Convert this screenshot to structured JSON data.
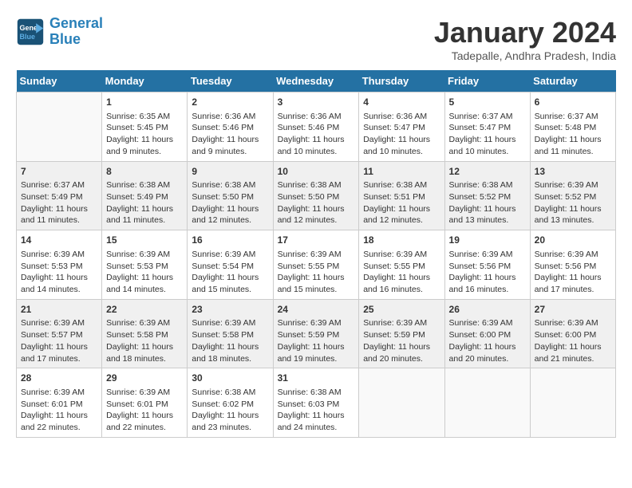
{
  "header": {
    "logo_line1": "General",
    "logo_line2": "Blue",
    "month_title": "January 2024",
    "subtitle": "Tadepalle, Andhra Pradesh, India"
  },
  "days_of_week": [
    "Sunday",
    "Monday",
    "Tuesday",
    "Wednesday",
    "Thursday",
    "Friday",
    "Saturday"
  ],
  "weeks": [
    [
      {
        "day": "",
        "info": ""
      },
      {
        "day": "1",
        "info": "Sunrise: 6:35 AM\nSunset: 5:45 PM\nDaylight: 11 hours\nand 9 minutes."
      },
      {
        "day": "2",
        "info": "Sunrise: 6:36 AM\nSunset: 5:46 PM\nDaylight: 11 hours\nand 9 minutes."
      },
      {
        "day": "3",
        "info": "Sunrise: 6:36 AM\nSunset: 5:46 PM\nDaylight: 11 hours\nand 10 minutes."
      },
      {
        "day": "4",
        "info": "Sunrise: 6:36 AM\nSunset: 5:47 PM\nDaylight: 11 hours\nand 10 minutes."
      },
      {
        "day": "5",
        "info": "Sunrise: 6:37 AM\nSunset: 5:47 PM\nDaylight: 11 hours\nand 10 minutes."
      },
      {
        "day": "6",
        "info": "Sunrise: 6:37 AM\nSunset: 5:48 PM\nDaylight: 11 hours\nand 11 minutes."
      }
    ],
    [
      {
        "day": "7",
        "info": "Sunrise: 6:37 AM\nSunset: 5:49 PM\nDaylight: 11 hours\nand 11 minutes."
      },
      {
        "day": "8",
        "info": "Sunrise: 6:38 AM\nSunset: 5:49 PM\nDaylight: 11 hours\nand 11 minutes."
      },
      {
        "day": "9",
        "info": "Sunrise: 6:38 AM\nSunset: 5:50 PM\nDaylight: 11 hours\nand 12 minutes."
      },
      {
        "day": "10",
        "info": "Sunrise: 6:38 AM\nSunset: 5:50 PM\nDaylight: 11 hours\nand 12 minutes."
      },
      {
        "day": "11",
        "info": "Sunrise: 6:38 AM\nSunset: 5:51 PM\nDaylight: 11 hours\nand 12 minutes."
      },
      {
        "day": "12",
        "info": "Sunrise: 6:38 AM\nSunset: 5:52 PM\nDaylight: 11 hours\nand 13 minutes."
      },
      {
        "day": "13",
        "info": "Sunrise: 6:39 AM\nSunset: 5:52 PM\nDaylight: 11 hours\nand 13 minutes."
      }
    ],
    [
      {
        "day": "14",
        "info": "Sunrise: 6:39 AM\nSunset: 5:53 PM\nDaylight: 11 hours\nand 14 minutes."
      },
      {
        "day": "15",
        "info": "Sunrise: 6:39 AM\nSunset: 5:53 PM\nDaylight: 11 hours\nand 14 minutes."
      },
      {
        "day": "16",
        "info": "Sunrise: 6:39 AM\nSunset: 5:54 PM\nDaylight: 11 hours\nand 15 minutes."
      },
      {
        "day": "17",
        "info": "Sunrise: 6:39 AM\nSunset: 5:55 PM\nDaylight: 11 hours\nand 15 minutes."
      },
      {
        "day": "18",
        "info": "Sunrise: 6:39 AM\nSunset: 5:55 PM\nDaylight: 11 hours\nand 16 minutes."
      },
      {
        "day": "19",
        "info": "Sunrise: 6:39 AM\nSunset: 5:56 PM\nDaylight: 11 hours\nand 16 minutes."
      },
      {
        "day": "20",
        "info": "Sunrise: 6:39 AM\nSunset: 5:56 PM\nDaylight: 11 hours\nand 17 minutes."
      }
    ],
    [
      {
        "day": "21",
        "info": "Sunrise: 6:39 AM\nSunset: 5:57 PM\nDaylight: 11 hours\nand 17 minutes."
      },
      {
        "day": "22",
        "info": "Sunrise: 6:39 AM\nSunset: 5:58 PM\nDaylight: 11 hours\nand 18 minutes."
      },
      {
        "day": "23",
        "info": "Sunrise: 6:39 AM\nSunset: 5:58 PM\nDaylight: 11 hours\nand 18 minutes."
      },
      {
        "day": "24",
        "info": "Sunrise: 6:39 AM\nSunset: 5:59 PM\nDaylight: 11 hours\nand 19 minutes."
      },
      {
        "day": "25",
        "info": "Sunrise: 6:39 AM\nSunset: 5:59 PM\nDaylight: 11 hours\nand 20 minutes."
      },
      {
        "day": "26",
        "info": "Sunrise: 6:39 AM\nSunset: 6:00 PM\nDaylight: 11 hours\nand 20 minutes."
      },
      {
        "day": "27",
        "info": "Sunrise: 6:39 AM\nSunset: 6:00 PM\nDaylight: 11 hours\nand 21 minutes."
      }
    ],
    [
      {
        "day": "28",
        "info": "Sunrise: 6:39 AM\nSunset: 6:01 PM\nDaylight: 11 hours\nand 22 minutes."
      },
      {
        "day": "29",
        "info": "Sunrise: 6:39 AM\nSunset: 6:01 PM\nDaylight: 11 hours\nand 22 minutes."
      },
      {
        "day": "30",
        "info": "Sunrise: 6:38 AM\nSunset: 6:02 PM\nDaylight: 11 hours\nand 23 minutes."
      },
      {
        "day": "31",
        "info": "Sunrise: 6:38 AM\nSunset: 6:03 PM\nDaylight: 11 hours\nand 24 minutes."
      },
      {
        "day": "",
        "info": ""
      },
      {
        "day": "",
        "info": ""
      },
      {
        "day": "",
        "info": ""
      }
    ]
  ]
}
